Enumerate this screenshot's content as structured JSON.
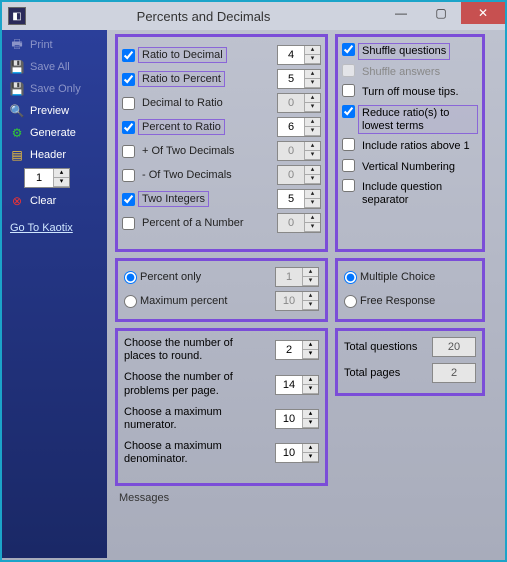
{
  "window": {
    "title": "Percents and Decimals"
  },
  "sidebar": {
    "print": "Print",
    "save_all": "Save All",
    "save_only": "Save Only",
    "preview": "Preview",
    "generate": "Generate",
    "header": "Header",
    "header_value": "1",
    "clear": "Clear",
    "link": "Go To Kaotix"
  },
  "panelA": {
    "items": [
      {
        "label": "Ratio to Decimal",
        "checked": true,
        "boxed": true,
        "value": "4",
        "enabled": true
      },
      {
        "label": "Ratio to Percent",
        "checked": true,
        "boxed": true,
        "value": "5",
        "enabled": true
      },
      {
        "label": "Decimal to Ratio",
        "checked": false,
        "boxed": false,
        "value": "0",
        "enabled": false
      },
      {
        "label": "Percent to Ratio",
        "checked": true,
        "boxed": true,
        "value": "6",
        "enabled": true
      },
      {
        "label": "+ Of Two Decimals",
        "checked": false,
        "boxed": false,
        "value": "0",
        "enabled": false
      },
      {
        "label": "- Of Two Decimals",
        "checked": false,
        "boxed": false,
        "value": "0",
        "enabled": false
      },
      {
        "label": "Two Integers",
        "checked": true,
        "boxed": true,
        "value": "5",
        "enabled": true
      },
      {
        "label": "Percent of a Number",
        "checked": false,
        "boxed": false,
        "value": "0",
        "enabled": false
      }
    ]
  },
  "panelB": {
    "shuffle_q": {
      "label": "Shuffle questions",
      "checked": true,
      "boxed": true
    },
    "shuffle_a": {
      "label": "Shuffle answers",
      "checked": false,
      "dim": true
    },
    "mouse_tips": {
      "label": "Turn off mouse tips.",
      "checked": false
    },
    "reduce": {
      "label": "Reduce ratio(s) to lowest terms",
      "checked": true,
      "boxed": true
    },
    "include_above1": {
      "label": "Include ratios above 1",
      "checked": false
    },
    "vertical": {
      "label": "Vertical Numbering",
      "checked": false
    },
    "separator": {
      "label": "Include question separator",
      "checked": false
    }
  },
  "panelC": {
    "percent_only": "Percent only",
    "maximum_percent": "Maximum percent",
    "val1": "1",
    "val2": "10"
  },
  "panelD": {
    "multiple": "Multiple Choice",
    "free": "Free Response"
  },
  "panelE": {
    "r1": {
      "txt": "Choose the number of places to round.",
      "val": "2"
    },
    "r2": {
      "txt": "Choose the number of problems per page.",
      "val": "14"
    },
    "r3": {
      "txt": "Choose a maximum numerator.",
      "val": "10"
    },
    "r4": {
      "txt": "Choose a maximum denominator.",
      "val": "10"
    }
  },
  "panelF": {
    "total_q_label": "Total questions",
    "total_q": "20",
    "total_p_label": "Total pages",
    "total_p": "2"
  },
  "messages_label": "Messages"
}
